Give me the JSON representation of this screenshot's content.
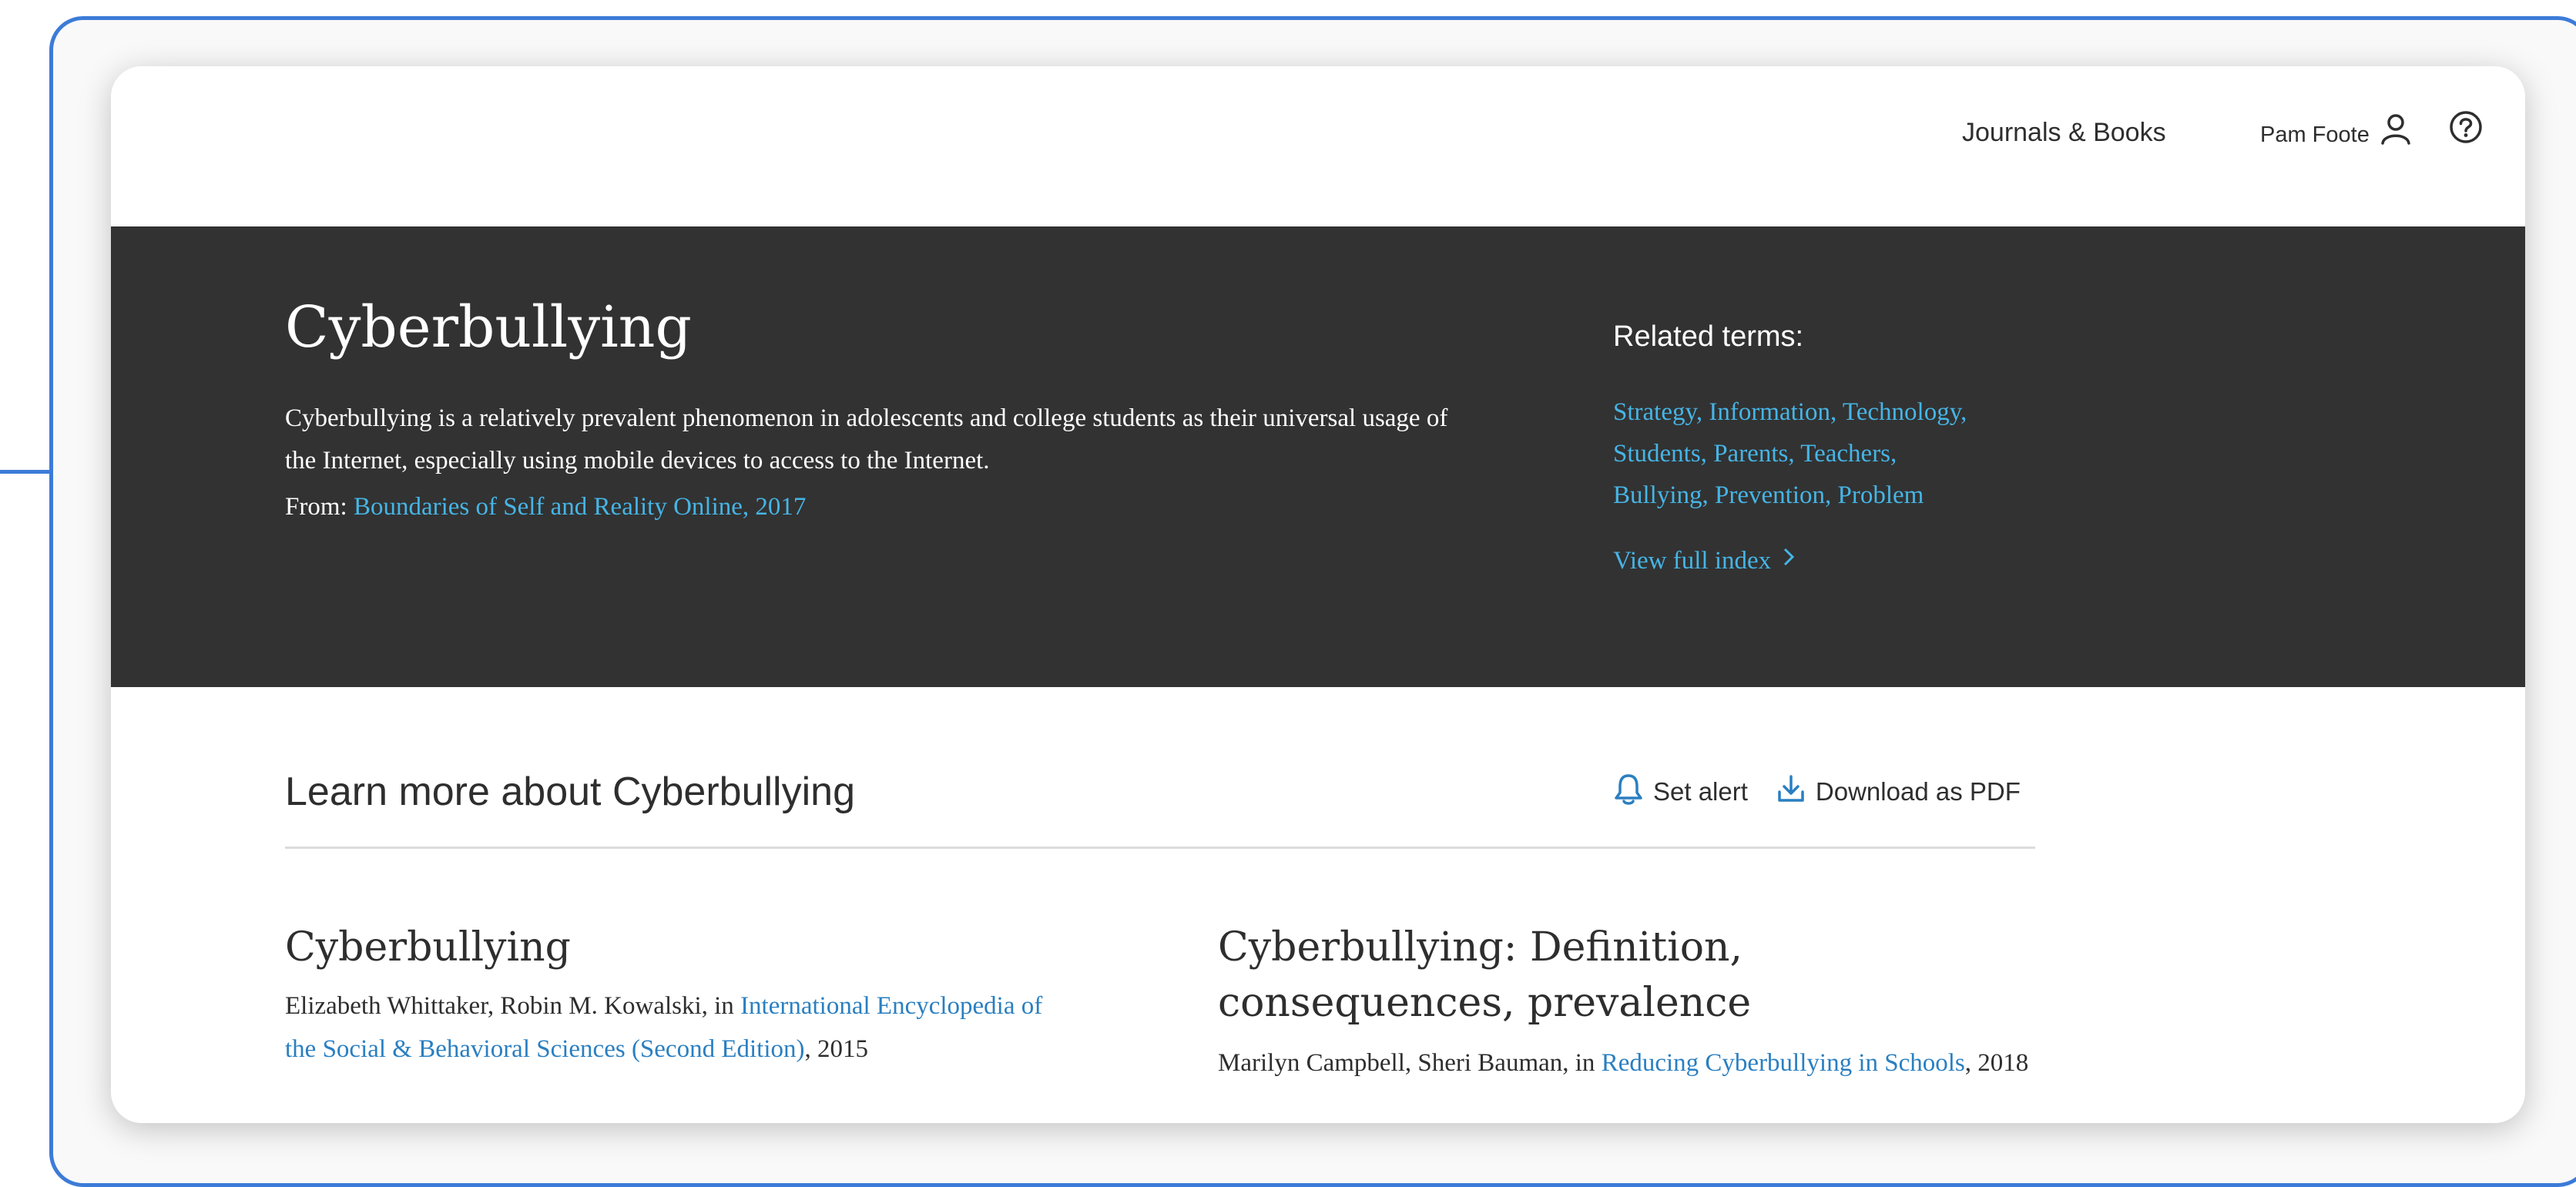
{
  "header": {
    "nav_journals": "Journals & Books",
    "user_name": "Pam Foote"
  },
  "hero": {
    "title": "Cyberbullying",
    "description": "Cyberbullying is a relatively prevalent phenomenon in adolescents and college students as their universal usage of the Internet, especially using mobile devices to access to the Internet.",
    "from_label": "From:",
    "from_link": "Boundaries of Self and Reality Online, 2017",
    "related_title": "Related terms:",
    "related_terms": [
      "Strategy,",
      "Information,",
      "Technology,",
      "Students,",
      "Parents,",
      "Teachers,",
      "Bullying,",
      "Prevention,",
      "Problem"
    ],
    "view_index": "View full index"
  },
  "learn": {
    "title": "Learn more about Cyberbullying",
    "set_alert": "Set alert",
    "download_pdf": "Download as PDF"
  },
  "articles": [
    {
      "title": "Cyberbullying",
      "authors": "Elizabeth Whittaker, Robin M. Kowalski, in",
      "source": "International Encyclopedia of the Social & Behavioral Sciences (Second Edition)",
      "year": ", 2015"
    },
    {
      "title": "Cyberbullying: Definition, consequences, prevalence",
      "authors": "Marilyn Campbell, Sheri Bauman, in",
      "source": "Reducing Cyberbullying in Schools",
      "year": ", 2018"
    }
  ],
  "colors": {
    "frame": "#3c7bd8",
    "hero_bg": "#323232",
    "link": "#46b5e6",
    "text": "#2e2e2e"
  },
  "icons": [
    "user-icon",
    "help-icon",
    "chevron-right-icon",
    "bell-icon",
    "download-icon"
  ]
}
